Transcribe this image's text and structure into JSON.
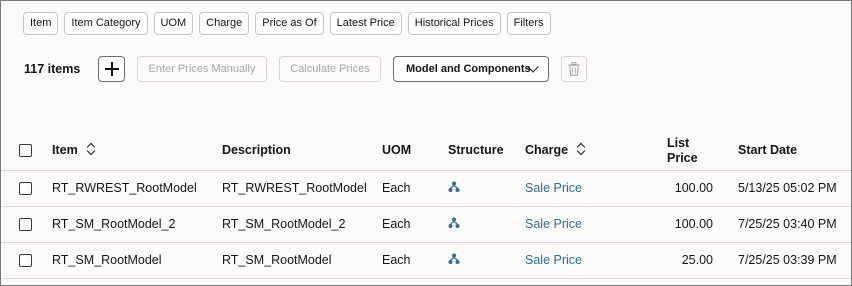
{
  "filters": [
    "Item",
    "Item Category",
    "UOM",
    "Charge",
    "Price as Of",
    "Latest Price",
    "Historical Prices",
    "Filters"
  ],
  "toolbar": {
    "count": "117 items",
    "enter_prices": "Enter Prices Manually",
    "calculate": "Calculate Prices",
    "model": "Model and Components"
  },
  "table": {
    "columns": {
      "item": "Item",
      "description": "Description",
      "uom": "UOM",
      "structure": "Structure",
      "charge": "Charge",
      "list_price_1": "List",
      "list_price_2": "Price",
      "start_date": "Start Date"
    },
    "rows": [
      {
        "item": "RT_RWREST_RootModel",
        "description": "RT_RWREST_RootModel",
        "uom": "Each",
        "charge": "Sale Price",
        "price": "100.00",
        "start": "5/13/25 05:02 PM"
      },
      {
        "item": "RT_SM_RootModel_2",
        "description": "RT_SM_RootModel_2",
        "uom": "Each",
        "charge": "Sale Price",
        "price": "100.00",
        "start": "7/25/25 03:40 PM"
      },
      {
        "item": "RT_SM_RootModel",
        "description": "RT_SM_RootModel",
        "uom": "Each",
        "charge": "Sale Price",
        "price": "25.00",
        "start": "7/25/25 03:39 PM"
      }
    ]
  },
  "colors": {
    "link": "#2f6e8f",
    "border": "#c9c6c2",
    "disabled_text": "#a8a6a3"
  },
  "icons": {
    "add": "plus-icon",
    "model_dropdown": "chevron-down-icon",
    "delete": "trash-icon",
    "structure": "structure-hierarchy-icon",
    "sort": "sort-icon"
  }
}
